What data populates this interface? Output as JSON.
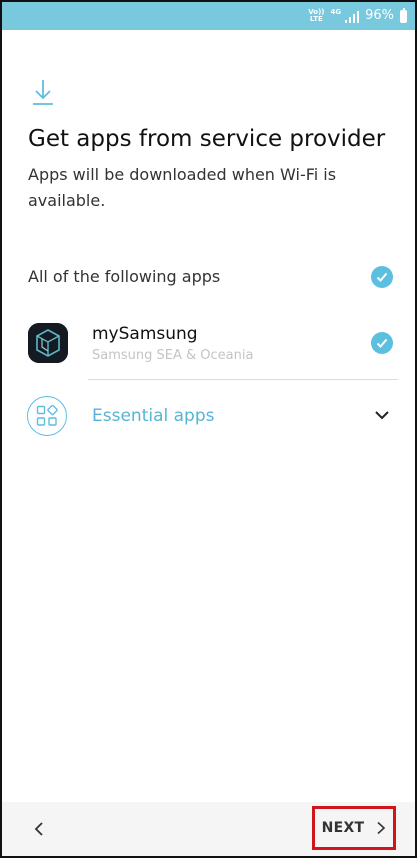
{
  "status_bar": {
    "volte": [
      "Vo))",
      "LTE"
    ],
    "network": "4G",
    "battery_pct": "96%",
    "battery_level": 0.96,
    "background": "#78c8de"
  },
  "header": {
    "icon": "download-icon",
    "title": "Get apps from service provider",
    "subtitle": "Apps will be downloaded when Wi-Fi is available."
  },
  "apps_section": {
    "all_label": "All of the following apps",
    "all_checked": true,
    "apps": [
      {
        "name": "mySamsung",
        "provider": "Samsung SEA & Oceania",
        "icon": "mysamsung-app-icon",
        "checked": true
      }
    ],
    "group": {
      "label": "Essential apps",
      "icon": "apps-grid-icon",
      "expand_icon": "chevron-down-icon"
    }
  },
  "bottom_bar": {
    "back_icon": "chevron-left-icon",
    "next_label": "NEXT",
    "next_icon": "chevron-right-icon"
  },
  "colors": {
    "accent": "#5bbfe0",
    "highlight_border": "#d0161b"
  }
}
